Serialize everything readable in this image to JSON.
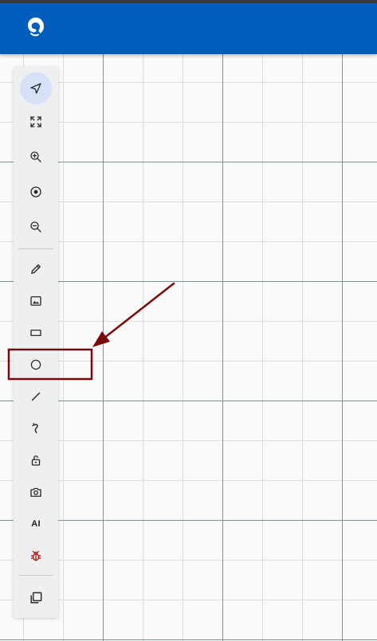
{
  "app": {
    "logo_icon": "chameleon-logo-icon",
    "header_color": "#005dbb"
  },
  "toolbar": {
    "tools": [
      {
        "id": "select",
        "icon": "navigation-arrow-icon",
        "active": true
      },
      {
        "id": "fit-to-screen",
        "icon": "fullscreen-icon"
      },
      {
        "id": "zoom-in",
        "icon": "zoom-in-icon"
      },
      {
        "id": "center",
        "icon": "target-icon"
      },
      {
        "id": "zoom-out",
        "icon": "zoom-out-icon"
      },
      {
        "id": "pencil",
        "icon": "pencil-icon"
      },
      {
        "id": "image",
        "icon": "image-icon"
      },
      {
        "id": "rectangle",
        "icon": "rectangle-icon"
      },
      {
        "id": "circle",
        "icon": "circle-icon"
      },
      {
        "id": "line",
        "icon": "line-icon"
      },
      {
        "id": "connector",
        "icon": "curved-connector-icon"
      },
      {
        "id": "lock",
        "icon": "unlock-icon"
      },
      {
        "id": "screenshot",
        "icon": "camera-icon"
      },
      {
        "id": "ai",
        "icon": "ai-icon",
        "label": "AI"
      },
      {
        "id": "debug",
        "icon": "bug-icon",
        "color": "#b00000"
      },
      {
        "id": "layers",
        "icon": "copy-icon"
      }
    ]
  },
  "annotation": {
    "color": "#7a0a0a",
    "target": "circle-tool"
  }
}
